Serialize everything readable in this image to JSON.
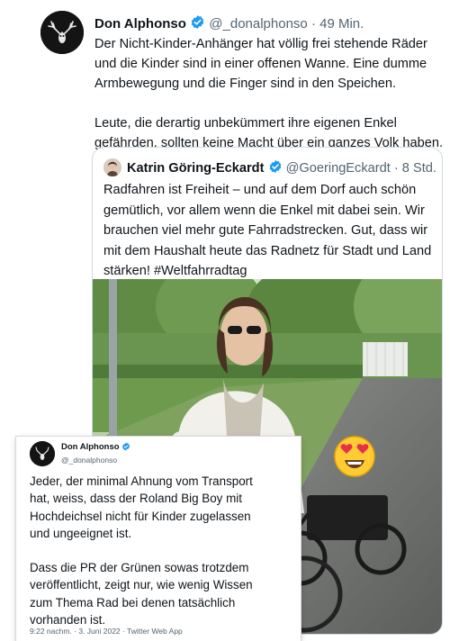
{
  "main_tweet": {
    "author_name": "Don Alphonso",
    "handle": "@_donalphonso",
    "separator": "·",
    "time": "49 Min.",
    "paragraph1_lines": [
      "Der Nicht-Kinder-Anhänger hat völlig frei stehende Räder",
      "und die Kinder sind in einer offenen Wanne. Eine dumme",
      "Armbewegung und die Finger sind in den Speichen."
    ],
    "paragraph2_lines": [
      "Leute, die derartig unbekümmert ihre eigenen Enkel",
      "gefährden, sollten keine Macht über ein ganzes Volk haben."
    ]
  },
  "quoted_tweet": {
    "author_name": "Katrin Göring-Eckardt",
    "handle": "@GoeringEckardt",
    "separator": "·",
    "time": "8 Std.",
    "text_lines": [
      "Radfahren ist Freiheit – und auf dem Dorf auch schön",
      "gemütlich, vor allem wenn die Enkel mit dabei sein. Wir",
      "brauchen viel mehr gute Fahrradstrecken. Gut, dass wir",
      "mit dem Haushalt heute das Radnetz für Stadt und Land",
      "stärken! #Weltfahrradtag"
    ]
  },
  "reply_tweet": {
    "author_name": "Don Alphonso",
    "handle": "@_donalphonso",
    "paragraph1_lines": [
      "Jeder, der minimal Ahnung vom Transport",
      "hat, weiss, dass der Roland Big Boy mit",
      "Hochdeichsel nicht für Kinder zugelassen",
      "und ungeeignet ist."
    ],
    "paragraph2_lines": [
      "Dass die PR der Grünen sowas trotzdem",
      "veröffentlicht, zeigt nur, wie wenig Wissen",
      "zum Thema Rad bei denen tatsächlich",
      "vorhanden ist."
    ],
    "footer": "9:22 nachm. · 3. Juni 2022 · Twitter Web App"
  },
  "colors": {
    "verified_blue": "#1d9bf0",
    "muted_text": "#536471",
    "primary_text": "#0f1419"
  },
  "icons": [
    "verified-badge-icon",
    "heart-eyes-emoji-icon"
  ]
}
